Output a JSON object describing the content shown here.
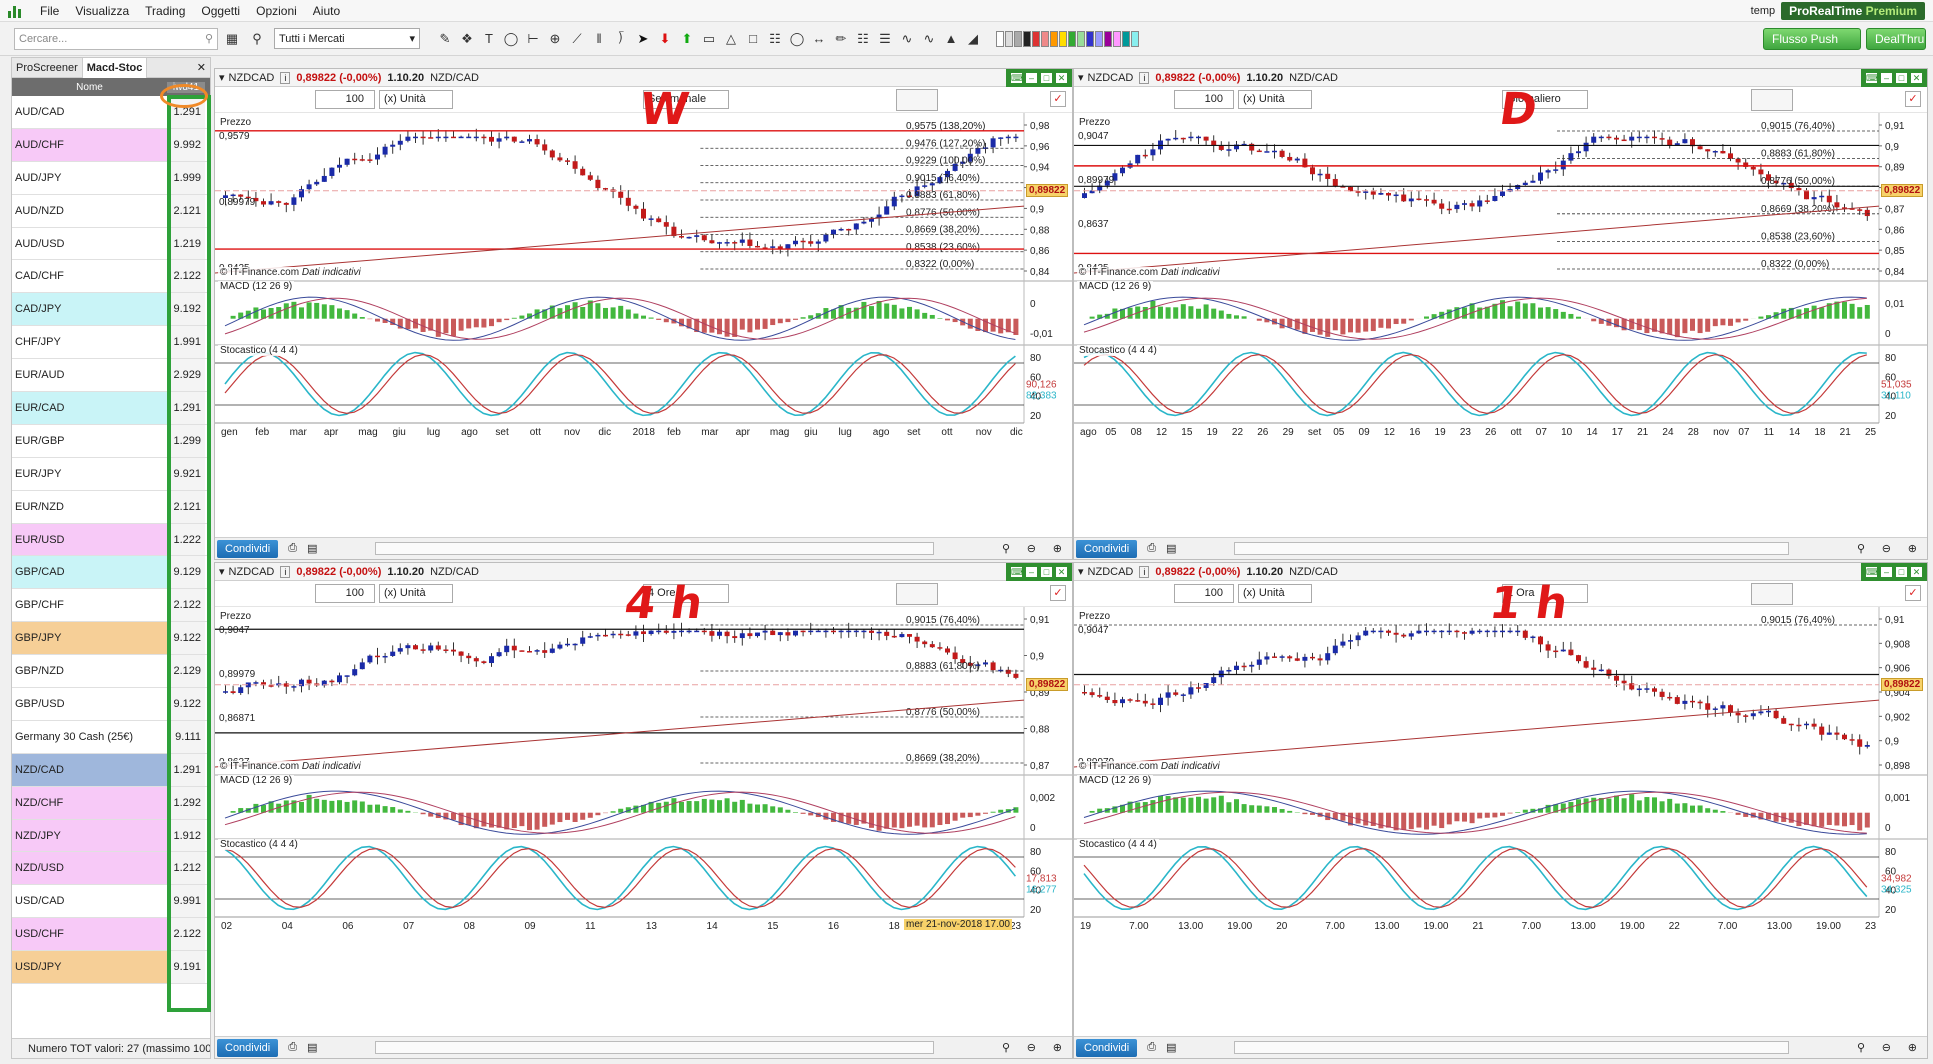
{
  "menu": {
    "items": [
      "File",
      "Visualizza",
      "Trading",
      "Oggetti",
      "Opzioni",
      "Aiuto"
    ],
    "user": "temp",
    "product_prefix": "ProRealTime",
    "product_suffix": "Premium"
  },
  "toolbar": {
    "search_placeholder": "Cercare...",
    "market": "Tutti i Mercati",
    "push_label": "Flusso Push",
    "broker_label": "DealThru"
  },
  "screener": {
    "tabs": [
      "ProScreener",
      "Macd-Stoc"
    ],
    "col_name": "Nome",
    "col_value": "iwd41",
    "rows": [
      {
        "name": "AUD/CAD",
        "value": "1.291",
        "color": "#ffffff"
      },
      {
        "name": "AUD/CHF",
        "value": "9.992",
        "color": "#f7c9f7"
      },
      {
        "name": "AUD/JPY",
        "value": "1.999",
        "color": "#ffffff"
      },
      {
        "name": "AUD/NZD",
        "value": "2.121",
        "color": "#ffffff"
      },
      {
        "name": "AUD/USD",
        "value": "1.219",
        "color": "#ffffff"
      },
      {
        "name": "CAD/CHF",
        "value": "2.122",
        "color": "#ffffff"
      },
      {
        "name": "CAD/JPY",
        "value": "9.192",
        "color": "#c9f4f7"
      },
      {
        "name": "CHF/JPY",
        "value": "1.991",
        "color": "#ffffff"
      },
      {
        "name": "EUR/AUD",
        "value": "2.929",
        "color": "#ffffff"
      },
      {
        "name": "EUR/CAD",
        "value": "1.291",
        "color": "#c9f4f7"
      },
      {
        "name": "EUR/GBP",
        "value": "1.299",
        "color": "#ffffff"
      },
      {
        "name": "EUR/JPY",
        "value": "9.921",
        "color": "#ffffff"
      },
      {
        "name": "EUR/NZD",
        "value": "2.121",
        "color": "#ffffff"
      },
      {
        "name": "EUR/USD",
        "value": "1.222",
        "color": "#f7c9f7"
      },
      {
        "name": "GBP/CAD",
        "value": "9.129",
        "color": "#c9f4f7"
      },
      {
        "name": "GBP/CHF",
        "value": "2.122",
        "color": "#ffffff"
      },
      {
        "name": "GBP/JPY",
        "value": "9.122",
        "color": "#f6cf97"
      },
      {
        "name": "GBP/NZD",
        "value": "2.129",
        "color": "#ffffff"
      },
      {
        "name": "GBP/USD",
        "value": "9.122",
        "color": "#ffffff"
      },
      {
        "name": "Germany 30 Cash (25€)",
        "value": "9.111",
        "color": "#ffffff"
      },
      {
        "name": "NZD/CAD",
        "value": "1.291",
        "color": "#9fb7dc"
      },
      {
        "name": "NZD/CHF",
        "value": "1.292",
        "color": "#f7c9f7"
      },
      {
        "name": "NZD/JPY",
        "value": "1.912",
        "color": "#f7c9f7"
      },
      {
        "name": "NZD/USD",
        "value": "1.212",
        "color": "#f7c9f7"
      },
      {
        "name": "USD/CAD",
        "value": "9.991",
        "color": "#ffffff"
      },
      {
        "name": "USD/CHF",
        "value": "2.122",
        "color": "#f7c9f7"
      },
      {
        "name": "USD/JPY",
        "value": "9.191",
        "color": "#f6cf97"
      }
    ],
    "footer": "Numero TOT valori: 27 (massimo 100"
  },
  "common": {
    "symbol": "NZDCAD",
    "change": "0,89822 (-0,00%)",
    "version": "1.10.20",
    "pair": "NZD/CAD",
    "qty": "100",
    "unit": "(x) Unità",
    "price_label": "Prezzo",
    "macd_label": "MACD (12 26 9)",
    "stoch_label": "Stocastico (4 4 4)",
    "source": "© IT-Finance.com",
    "source_note": "Dati indicativi",
    "share": "Condividi",
    "last_price": "0,89822"
  },
  "charts": [
    {
      "id": "weekly",
      "timeframe": "Settimanale",
      "annotation": "W",
      "price_axis": [
        "0,98",
        "0,96",
        "0,94",
        "0,92",
        "0,9",
        "0,88",
        "0,86",
        "0,84"
      ],
      "levels": [
        "0,9575 (138,20%)",
        "0,9476 (127,20%)",
        "0,9229 (100,00%)",
        "0,9015 (76,40%)",
        "0,8883 (61,80%)",
        "0,8776 (50,00%)",
        "0,8669 (38,20%)",
        "0,8538 (23,60%)",
        "0,8322 (0,00%)"
      ],
      "left_labels": [
        "0,9579",
        "0,89979",
        "0,8425"
      ],
      "macd_axis": [
        "0",
        "-0,01"
      ],
      "stoch_axis": [
        "80",
        "60",
        "40",
        "20"
      ],
      "stoch_values": [
        "90,126",
        "82,383"
      ],
      "time_axis": [
        "gen",
        "feb",
        "mar",
        "apr",
        "mag",
        "giu",
        "lug",
        "ago",
        "set",
        "ott",
        "nov",
        "dic",
        "2018",
        "feb",
        "mar",
        "apr",
        "mag",
        "giu",
        "lug",
        "ago",
        "set",
        "ott",
        "nov",
        "dic"
      ]
    },
    {
      "id": "daily",
      "timeframe": "Giornaliero",
      "annotation": "D",
      "price_axis": [
        "0,91",
        "0,9",
        "0,89",
        "0,88",
        "0,87",
        "0,86",
        "0,85",
        "0,84"
      ],
      "levels": [
        "0,9015 (76,40%)",
        "0,8883 (61,80%)",
        "0,8776 (50,00%)",
        "0,8669 (38,20%)",
        "0,8538 (23,60%)",
        "0,8322 (0,00%)"
      ],
      "left_labels": [
        "0,9047",
        "0,89979",
        "0,8637",
        "0,8425"
      ],
      "macd_axis": [
        "0,01",
        "0"
      ],
      "stoch_axis": [
        "80",
        "60",
        "40",
        "20"
      ],
      "stoch_values": [
        "51,035",
        "31,110"
      ],
      "time_axis": [
        "ago",
        "05",
        "08",
        "12",
        "15",
        "19",
        "22",
        "26",
        "29",
        "set",
        "05",
        "09",
        "12",
        "16",
        "19",
        "23",
        "26",
        "ott",
        "07",
        "10",
        "14",
        "17",
        "21",
        "24",
        "28",
        "nov",
        "07",
        "11",
        "14",
        "18",
        "21",
        "25"
      ]
    },
    {
      "id": "h4",
      "timeframe": "4 Ore",
      "annotation": "4 h",
      "price_axis": [
        "0,91",
        "0,9",
        "0,89",
        "0,88",
        "0,87"
      ],
      "levels": [
        "0,9015 (76,40%)",
        "0,8883 (61,80%)",
        "0,8776 (50,00%)",
        "0,8669 (38,20%)"
      ],
      "left_labels": [
        "0,9047",
        "0,89979",
        "0,86871",
        "0,8637"
      ],
      "macd_axis": [
        "0,002",
        "0"
      ],
      "stoch_axis": [
        "80",
        "60",
        "40",
        "20"
      ],
      "stoch_values": [
        "17,813",
        "16,277"
      ],
      "time_axis": [
        "02",
        "04",
        "06",
        "07",
        "08",
        "09",
        "11",
        "13",
        "14",
        "15",
        "16",
        "18",
        "20",
        "23"
      ],
      "cursor_label": "mer 21-nov-2018 17.00"
    },
    {
      "id": "h1",
      "timeframe": "1 Ora",
      "annotation": "1 h",
      "price_axis": [
        "0,91",
        "0,908",
        "0,906",
        "0,904",
        "0,902",
        "0,9",
        "0,898"
      ],
      "levels": [
        "0,9015 (76,40%)"
      ],
      "left_labels": [
        "0,9047",
        "0,89979"
      ],
      "macd_axis": [
        "0,001",
        "0"
      ],
      "stoch_axis": [
        "80",
        "60",
        "40",
        "20"
      ],
      "stoch_values": [
        "34,982",
        "34,325"
      ],
      "time_axis": [
        "19",
        "7.00",
        "13.00",
        "19.00",
        "20",
        "7.00",
        "13.00",
        "19.00",
        "21",
        "7.00",
        "13.00",
        "19.00",
        "22",
        "7.00",
        "13.00",
        "19.00",
        "23"
      ]
    }
  ],
  "colors": {
    "bull": "#1a2aa8",
    "bear": "#c21a1a",
    "macd_pos": "#43b83e",
    "macd_neg": "#c95a5a",
    "stoch_k": "#2ab6c9",
    "stoch_d": "#c43a3a",
    "highlight": "#2ea13a"
  }
}
